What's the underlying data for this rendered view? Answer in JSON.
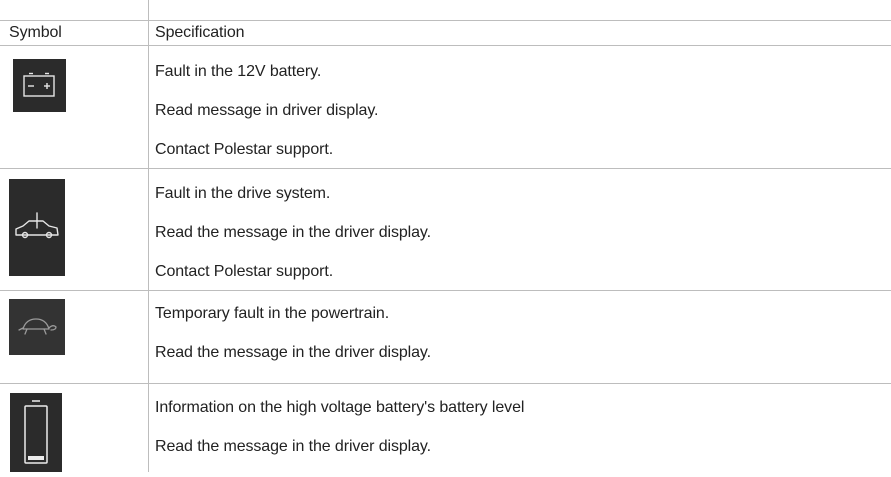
{
  "headers": {
    "symbol": "Symbol",
    "specification": "Specification"
  },
  "rows": [
    {
      "icon": "12v-battery-icon",
      "lines": [
        "Fault in the 12V battery.",
        "Read message in driver display.",
        "Contact Polestar support."
      ]
    },
    {
      "icon": "car-fault-icon",
      "lines": [
        "Fault in the drive system.",
        "Read the message in the driver display.",
        "Contact Polestar support."
      ]
    },
    {
      "icon": "turtle-icon",
      "lines": [
        "Temporary fault in the powertrain.",
        "Read the message in the driver display."
      ]
    },
    {
      "icon": "hv-battery-level-icon",
      "lines": [
        "Information on the high voltage battery's battery level",
        "Read the message in the driver display."
      ]
    }
  ]
}
